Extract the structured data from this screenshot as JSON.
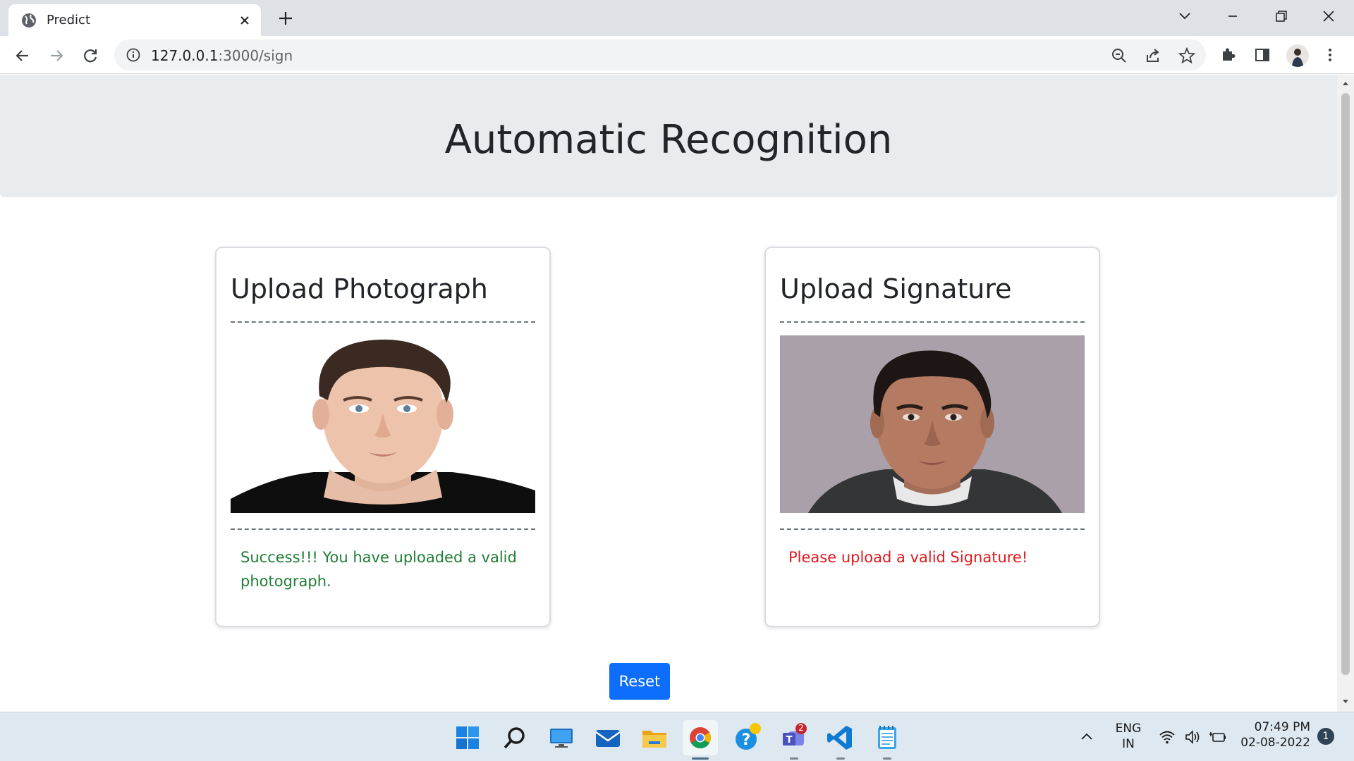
{
  "browser": {
    "tab_title": "Predict",
    "url_host": "127.0.0.1",
    "url_rest": ":3000/sign"
  },
  "page": {
    "title": "Automatic Recognition",
    "photo_card": {
      "heading": "Upload Photograph",
      "message": "Success!!! You have uploaded a valid photograph.",
      "message_status": "success",
      "message_color": "#1e7e34"
    },
    "signature_card": {
      "heading": "Upload Signature",
      "message": "Please upload a valid Signature!",
      "message_status": "error",
      "message_color": "#e3171b"
    },
    "reset_label": "Reset",
    "accent_color": "#0d6efd"
  },
  "taskbar": {
    "icons": [
      "windows-start-icon",
      "search-icon",
      "desktop-icon",
      "mail-icon",
      "file-explorer-icon",
      "chrome-icon",
      "help-icon",
      "teams-icon",
      "vscode-icon",
      "notepad-icon"
    ],
    "teams_badge": "2",
    "lang_line1": "ENG",
    "lang_line2": "IN",
    "time": "07:49 PM",
    "date": "02-08-2022",
    "notification_count": "1"
  }
}
